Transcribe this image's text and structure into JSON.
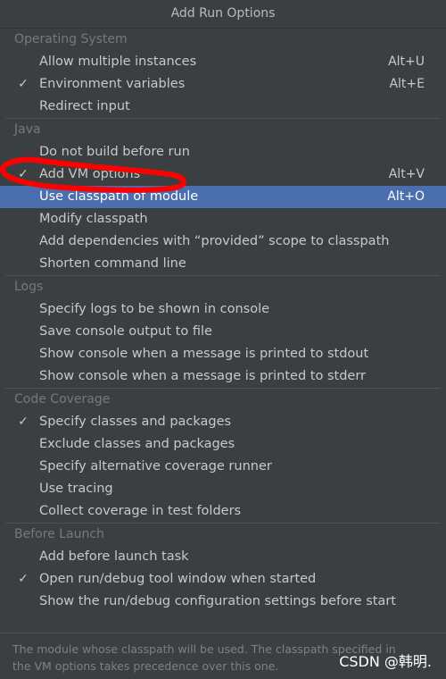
{
  "window": {
    "title": "Add Run Options"
  },
  "sections": [
    {
      "header": "Operating System",
      "items": [
        {
          "label": "Allow multiple instances",
          "shortcut": "Alt+U",
          "checked": false
        },
        {
          "label": "Environment variables",
          "shortcut": "Alt+E",
          "checked": true
        },
        {
          "label": "Redirect input",
          "shortcut": "",
          "checked": false
        }
      ]
    },
    {
      "header": "Java",
      "items": [
        {
          "label": "Do not build before run",
          "shortcut": "",
          "checked": false
        },
        {
          "label": "Add VM options",
          "shortcut": "Alt+V",
          "checked": true
        },
        {
          "label": "Use classpath of module",
          "shortcut": "Alt+O",
          "checked": false,
          "selected": true
        },
        {
          "label": "Modify classpath",
          "shortcut": "",
          "checked": false
        },
        {
          "label": "Add dependencies with “provided” scope to classpath",
          "shortcut": "",
          "checked": false
        },
        {
          "label": "Shorten command line",
          "shortcut": "",
          "checked": false
        }
      ]
    },
    {
      "header": "Logs",
      "items": [
        {
          "label": "Specify logs to be shown in console",
          "shortcut": "",
          "checked": false
        },
        {
          "label": "Save console output to file",
          "shortcut": "",
          "checked": false
        },
        {
          "label": "Show console when a message is printed to stdout",
          "shortcut": "",
          "checked": false
        },
        {
          "label": "Show console when a message is printed to stderr",
          "shortcut": "",
          "checked": false
        }
      ]
    },
    {
      "header": "Code Coverage",
      "items": [
        {
          "label": "Specify classes and packages",
          "shortcut": "",
          "checked": true
        },
        {
          "label": "Exclude classes and packages",
          "shortcut": "",
          "checked": false
        },
        {
          "label": "Specify alternative coverage runner",
          "shortcut": "",
          "checked": false
        },
        {
          "label": "Use tracing",
          "shortcut": "",
          "checked": false
        },
        {
          "label": "Collect coverage in test folders",
          "shortcut": "",
          "checked": false
        }
      ]
    },
    {
      "header": "Before Launch",
      "items": [
        {
          "label": "Add before launch task",
          "shortcut": "",
          "checked": false
        },
        {
          "label": "Open run/debug tool window when started",
          "shortcut": "",
          "checked": true
        },
        {
          "label": "Show the run/debug configuration settings before start",
          "shortcut": "",
          "checked": false
        }
      ]
    }
  ],
  "footer": {
    "description": "The module whose classpath will be used. The classpath specified in the VM options takes precedence over this one.",
    "watermark": "CSDN @韩明."
  },
  "icons": {
    "check": "check-icon"
  },
  "colors": {
    "background": "#3c3f41",
    "selected": "#4b6eaf",
    "annotation": "#ff0000"
  }
}
